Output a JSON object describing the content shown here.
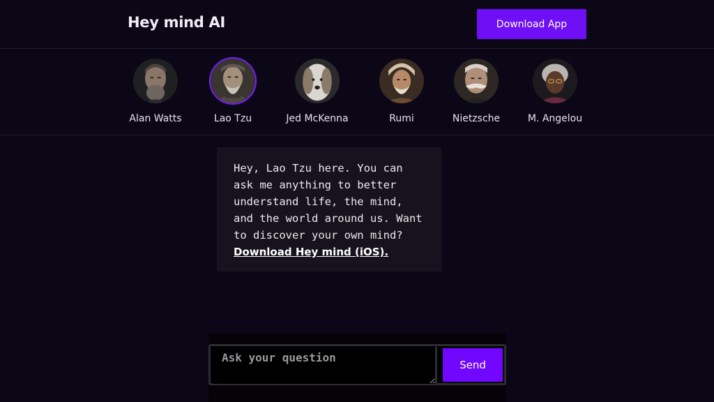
{
  "header": {
    "title": "Hey mind AI",
    "download_label": "Download App"
  },
  "personas": [
    {
      "name": "Alan Watts",
      "active": false
    },
    {
      "name": "Lao Tzu",
      "active": true
    },
    {
      "name": "Jed McKenna",
      "active": false
    },
    {
      "name": "Rumi",
      "active": false
    },
    {
      "name": "Nietzsche",
      "active": false
    },
    {
      "name": "M. Angelou",
      "active": false
    }
  ],
  "chat": {
    "message_text": "Hey, Lao Tzu here. You can ask me anything to better understand life, the mind, and the world around us. Want to discover your own mind? ",
    "link_text": "Download Hey mind (iOS)."
  },
  "composer": {
    "placeholder": "Ask your question",
    "value": "",
    "send_label": "Send"
  },
  "colors": {
    "background": "#0c0717",
    "accent": "#6f0ff5",
    "message_bg": "#16131e"
  }
}
